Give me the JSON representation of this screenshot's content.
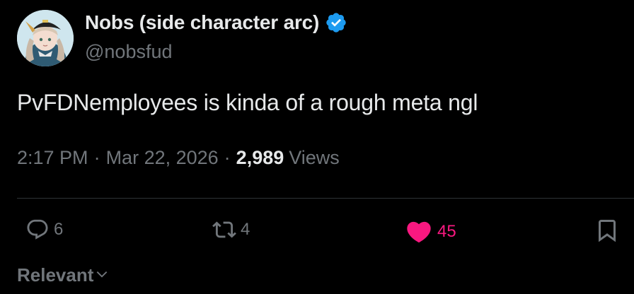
{
  "author": {
    "display_name": "Nobs (side character arc)",
    "handle": "@nobsfud",
    "verified": true
  },
  "tweet": {
    "text": "PvFDNemployees is kinda of a rough meta ngl",
    "time": "2:17 PM",
    "date": "Mar 22, 2026",
    "separator": "·",
    "views_count": "2,989",
    "views_label": "Views"
  },
  "actions": {
    "replies": "6",
    "retweets": "4",
    "likes": "45",
    "liked": true
  },
  "sort": {
    "label": "Relevant"
  },
  "colors": {
    "background": "#000000",
    "primary_text": "#e7e9ea",
    "secondary_text": "#71767b",
    "verified": "#1d9bf0",
    "like": "#f91880",
    "divider": "#2f3336"
  }
}
